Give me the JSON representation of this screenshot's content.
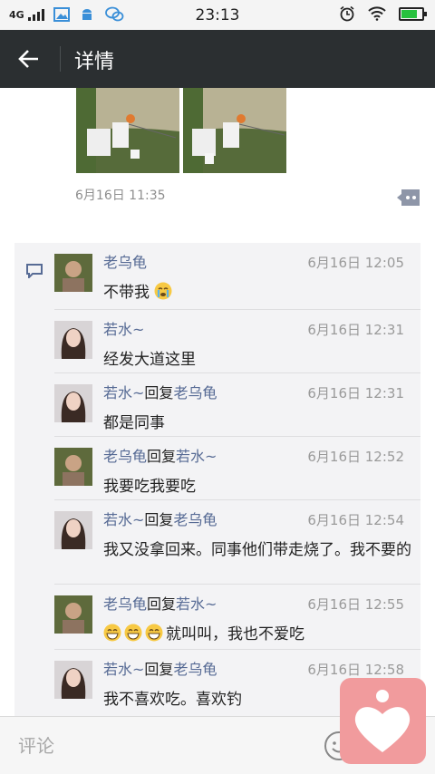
{
  "status_bar": {
    "time": "23:13",
    "network": "4G"
  },
  "header": {
    "title": "详情"
  },
  "post": {
    "timestamp": "6月16日 11:35"
  },
  "comments": [
    {
      "name": "老乌龟",
      "reply_word": "",
      "reply_to": "",
      "time": "6月16日 12:05",
      "text": "不带我",
      "emoji_after": 1,
      "emoji_before": 0
    },
    {
      "name": "若水~",
      "reply_word": "",
      "reply_to": "",
      "time": "6月16日 12:31",
      "text": "经发大道这里",
      "emoji_after": 0,
      "emoji_before": 0
    },
    {
      "name": "若水~",
      "reply_word": "回复",
      "reply_to": "老乌龟",
      "time": "6月16日 12:31",
      "text": "都是同事",
      "emoji_after": 0,
      "emoji_before": 0
    },
    {
      "name": "老乌龟",
      "reply_word": "回复",
      "reply_to": "若水~",
      "time": "6月16日 12:52",
      "text": "我要吃我要吃",
      "emoji_after": 0,
      "emoji_before": 0
    },
    {
      "name": "若水~",
      "reply_word": "回复",
      "reply_to": "老乌龟",
      "time": "6月16日 12:54",
      "text": "我又没拿回来。同事他们带走烧了。我不要的",
      "emoji_after": 0,
      "emoji_before": 0
    },
    {
      "name": "老乌龟",
      "reply_word": "回复",
      "reply_to": "若水~",
      "time": "6月16日 12:55",
      "text": "就叫叫，我也不爱吃",
      "emoji_after": 0,
      "emoji_before": 3
    },
    {
      "name": "若水~",
      "reply_word": "回复",
      "reply_to": "老乌龟",
      "time": "6月16日 12:58",
      "text": "我不喜欢吃。喜欢钓",
      "emoji_after": 0,
      "emoji_before": 0
    }
  ],
  "comment_input": {
    "placeholder": "评论"
  },
  "colors": {
    "title_bar": "#2b2f31",
    "name_link": "#576b95",
    "floating_button": "#f19b9d",
    "battery": "#27c13e"
  },
  "icons": {
    "back": "arrow-left-icon",
    "comment_toggle": "comment-bubble-icon",
    "thread": "comment-icon",
    "emoji": "smiley-icon",
    "floating": "heart-person-icon"
  }
}
